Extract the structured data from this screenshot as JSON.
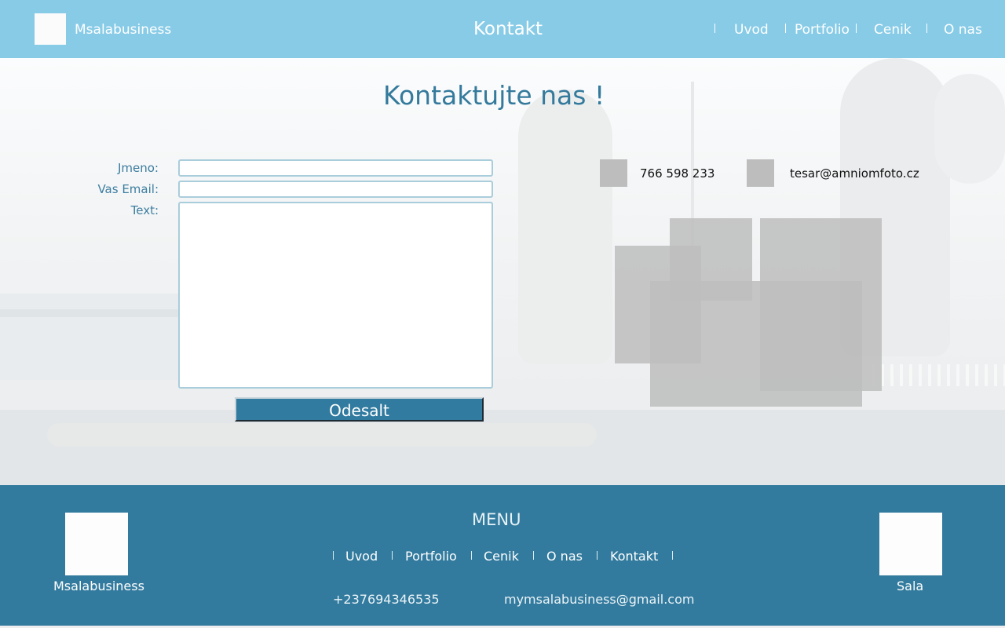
{
  "header": {
    "brand": "Msalabusiness",
    "page_title": "Kontakt",
    "nav": [
      "Uvod",
      "Portfolio",
      "Cenik",
      "O nas"
    ]
  },
  "form": {
    "heading": "Kontaktujte nas !",
    "name_label": "Jmeno:",
    "email_label": "Vas Email:",
    "text_label": "Text:",
    "name_value": "",
    "email_value": "",
    "text_value": "",
    "submit_label": "Odesalt"
  },
  "contact": {
    "phone": "766 598 233",
    "email": "tesar@amniomfoto.cz",
    "phone_icon": "phone-icon",
    "email_icon": "email-icon"
  },
  "footer": {
    "left_caption": "Msalabusiness",
    "right_caption": "Sala",
    "menu_title": "MENU",
    "nav": [
      "Uvod",
      "Portfolio",
      "Cenik",
      "O nas",
      "Kontakt"
    ],
    "phone": "+237694346535",
    "email": "mymsalabusiness@gmail.com"
  },
  "colors": {
    "header_bg": "#87cbe7",
    "footer_bg": "#337b9e",
    "accent": "#317ba0",
    "heading_text": "#347a9c",
    "placeholder_gray": "#bdbdbd"
  }
}
